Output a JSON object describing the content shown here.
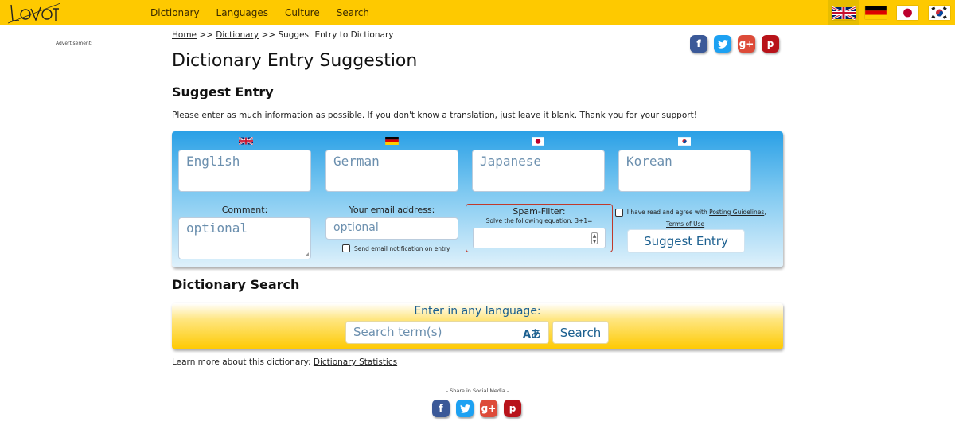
{
  "header": {
    "logo_text": "LOVOT",
    "nav": [
      "Dictionary",
      "Languages",
      "Culture",
      "Search"
    ],
    "flags": [
      {
        "icon": "flag-uk-icon",
        "active": true
      },
      {
        "icon": "flag-de-icon",
        "active": false
      },
      {
        "icon": "flag-jp-icon",
        "active": false
      },
      {
        "icon": "flag-kr-icon",
        "active": false
      }
    ]
  },
  "ad_label": "Advertisement:",
  "breadcrumb": {
    "home": "Home",
    "sep1": " >> ",
    "dictionary": "Dictionary",
    "sep2": " >> ",
    "current": "Suggest Entry to Dictionary"
  },
  "social": {
    "facebook": "f",
    "twitter": "t",
    "googleplus": "g+",
    "pinterest": "p"
  },
  "page_title": "Dictionary Entry Suggestion",
  "suggest": {
    "heading": "Suggest Entry",
    "intro": "Please enter as much information as possible. If you don't know a translation, just leave it blank. Thank you for your support!",
    "fields": {
      "english_placeholder": "English",
      "german_placeholder": "German",
      "japanese_placeholder": "Japanese",
      "korean_placeholder": "Korean"
    },
    "comment_label": "Comment:",
    "comment_placeholder": "optional",
    "email_label": "Your email address:",
    "email_placeholder": "optional",
    "notify_label": "Send email notification on entry",
    "spam_title": "Spam-Filter:",
    "spam_question": "Solve the following equation: 3+1=",
    "agree_text": "I have read and agree with",
    "agree_link1": "Posting Guidelines",
    "agree_comma": ",",
    "agree_link2": "Terms of Use",
    "submit_label": "Suggest Entry"
  },
  "search": {
    "heading": "Dictionary Search",
    "label": "Enter in any language:",
    "placeholder": "Search term(s)",
    "lang_icon": "Aあ",
    "button": "Search"
  },
  "learn": {
    "text": "Learn more about this dictionary: ",
    "link": "Dictionary Statistics"
  },
  "share_label": "- Share in Social Media -",
  "colors": {
    "topbar": "#fec900",
    "panel_blue": "#2aa0e6",
    "link_blue": "#1b5f8f",
    "spam_border": "#c0392b"
  }
}
